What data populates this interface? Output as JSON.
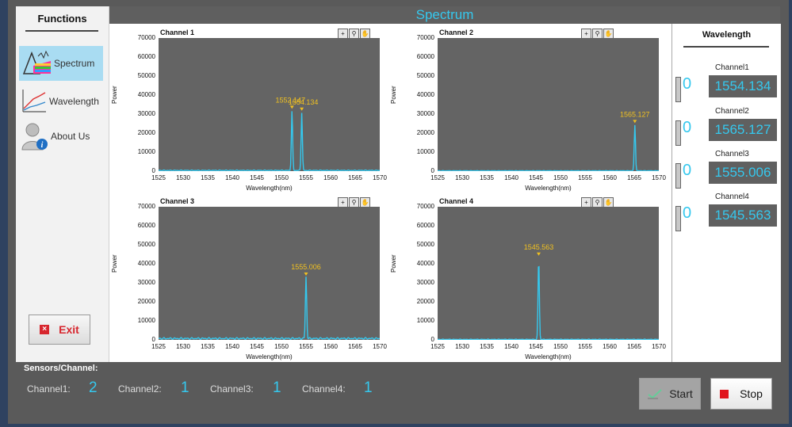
{
  "sidebar": {
    "title": "Functions",
    "items": [
      {
        "label": "Spectrum",
        "icon": "spectrum-icon",
        "active": true
      },
      {
        "label": "Wavelength",
        "icon": "wavelength-chart-icon",
        "active": false
      },
      {
        "label": "About Us",
        "icon": "user-info-icon",
        "active": false
      }
    ],
    "exit_label": "Exit"
  },
  "header": {
    "title": "Spectrum"
  },
  "wavelength_panel": {
    "title": "Wavelength",
    "channels": [
      {
        "name": "Channel1",
        "index": "0",
        "value": "1554.134"
      },
      {
        "name": "Channel2",
        "index": "0",
        "value": "1565.127"
      },
      {
        "name": "Channel3",
        "index": "0",
        "value": "1555.006"
      },
      {
        "name": "Channel4",
        "index": "0",
        "value": "1545.563"
      }
    ]
  },
  "sensors": {
    "title": "Sensors/Channel:",
    "items": [
      {
        "label": "Channel1:",
        "count": "2"
      },
      {
        "label": "Channel2:",
        "count": "1"
      },
      {
        "label": "Channel3:",
        "count": "1"
      },
      {
        "label": "Channel4:",
        "count": "1"
      }
    ]
  },
  "buttons": {
    "start": "Start",
    "stop": "Stop"
  },
  "colors": {
    "accent": "#35c8ee",
    "plot_bg": "#646464",
    "peak_label": "#f0c020",
    "exit": "#d7262e"
  },
  "chart_data": [
    {
      "type": "line",
      "title": "Channel 1",
      "xlabel": "Wavelength(nm)",
      "ylabel": "Power",
      "xlim": [
        1525,
        1570
      ],
      "ylim": [
        0,
        70000
      ],
      "xticks": [
        1525,
        1530,
        1535,
        1540,
        1545,
        1550,
        1555,
        1560,
        1565,
        1570
      ],
      "yticks": [
        0,
        10000,
        20000,
        30000,
        40000,
        50000,
        60000,
        70000
      ],
      "peaks": [
        {
          "x": 1552.147,
          "y": 31500,
          "label": "1552.147"
        },
        {
          "x": 1554.134,
          "y": 30500,
          "label": "1554.134"
        }
      ],
      "baseline": 600
    },
    {
      "type": "line",
      "title": "Channel 2",
      "xlabel": "Wavelength(nm)",
      "ylabel": "Power",
      "xlim": [
        1525,
        1570
      ],
      "ylim": [
        0,
        70000
      ],
      "xticks": [
        1525,
        1530,
        1535,
        1540,
        1545,
        1550,
        1555,
        1560,
        1565,
        1570
      ],
      "yticks": [
        0,
        10000,
        20000,
        30000,
        40000,
        50000,
        60000,
        70000
      ],
      "peaks": [
        {
          "x": 1565.127,
          "y": 24000,
          "label": "1565.127"
        }
      ],
      "baseline": 300
    },
    {
      "type": "line",
      "title": "Channel 3",
      "xlabel": "Wavelength(nm)",
      "ylabel": "Power",
      "xlim": [
        1525,
        1570
      ],
      "ylim": [
        0,
        70000
      ],
      "xticks": [
        1525,
        1530,
        1535,
        1540,
        1545,
        1550,
        1555,
        1560,
        1565,
        1570
      ],
      "yticks": [
        0,
        10000,
        20000,
        30000,
        40000,
        50000,
        60000,
        70000
      ],
      "peaks": [
        {
          "x": 1555.006,
          "y": 32500,
          "label": "1555.006"
        }
      ],
      "baseline": 1200
    },
    {
      "type": "line",
      "title": "Channel 4",
      "xlabel": "Wavelength(nm)",
      "ylabel": "Power",
      "xlim": [
        1525,
        1570
      ],
      "ylim": [
        0,
        70000
      ],
      "xticks": [
        1525,
        1530,
        1535,
        1540,
        1545,
        1550,
        1555,
        1560,
        1565,
        1570
      ],
      "yticks": [
        0,
        10000,
        20000,
        30000,
        40000,
        50000,
        60000,
        70000
      ],
      "peaks": [
        {
          "x": 1545.563,
          "y": 43000,
          "label": "1545.563"
        }
      ],
      "baseline": 400
    }
  ]
}
